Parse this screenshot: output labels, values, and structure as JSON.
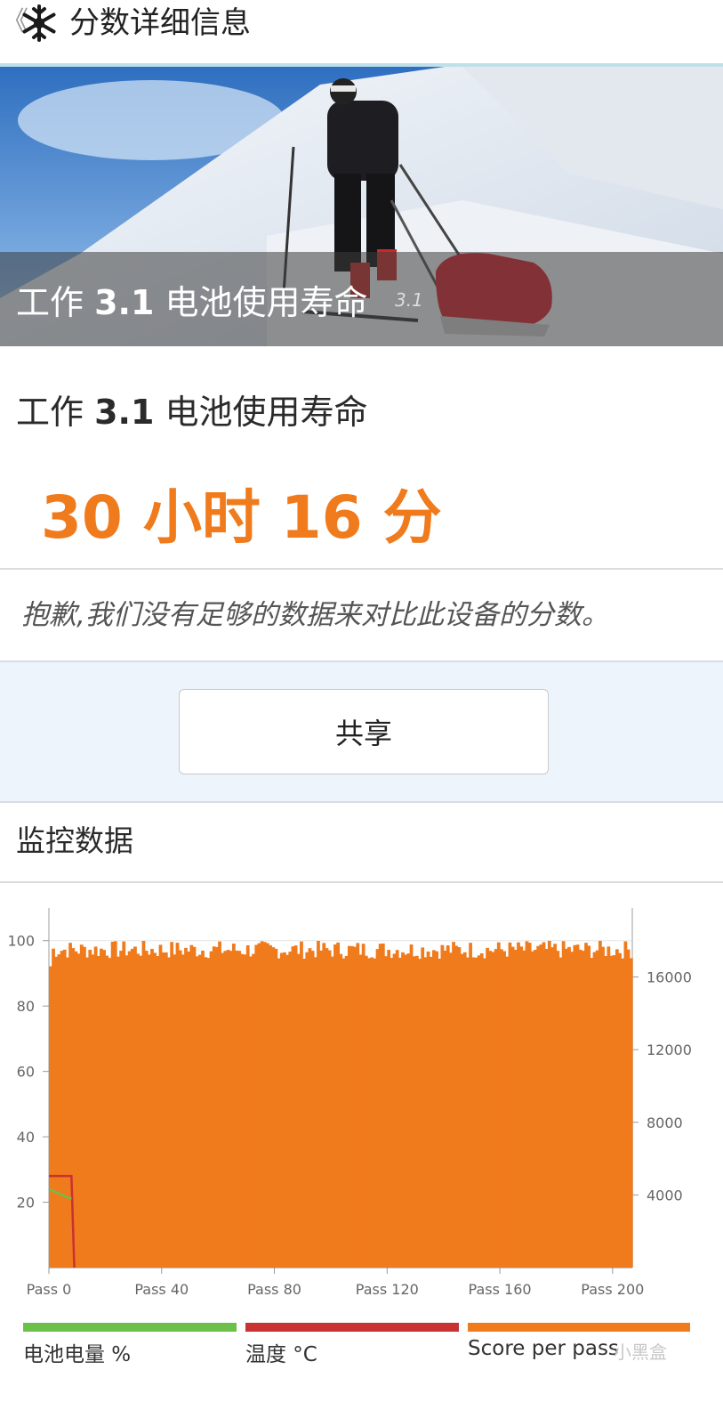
{
  "header": {
    "back_glyph": "《",
    "logo_icon": "snowflake-icon",
    "title": "分数详细信息"
  },
  "hero": {
    "label_pre": "工作 ",
    "label_num": "3.1",
    "label_post": " 电池使用寿命",
    "version": "3.1"
  },
  "result": {
    "name_pre": "工作 ",
    "name_num": "3.1",
    "name_post": " 电池使用寿命",
    "score": "30 小时 16 分",
    "no_compare": "抱歉,我们没有足够的数据来对比此设备的分数。"
  },
  "share_label": "共享",
  "monitor_title": "监控数据",
  "colors": {
    "accent": "#f07b1d",
    "battery": "#6cc04a",
    "temperature": "#c83232",
    "score": "#f07b1d"
  },
  "chart_data": {
    "type": "bar",
    "x_ticks": [
      "Pass 0",
      "Pass 40",
      "Pass 80",
      "Pass 120",
      "Pass 160",
      "Pass 200"
    ],
    "x_range": [
      0,
      207
    ],
    "y_left_ticks": [
      "100",
      "80",
      "60",
      "40",
      "20"
    ],
    "y_left_range": [
      0,
      110
    ],
    "y_right_ticks": [
      "16000",
      "12000",
      "8000",
      "4000"
    ],
    "y_right_range": [
      0,
      19800
    ],
    "series": [
      {
        "name": "电池电量 %",
        "axis": "left",
        "type": "line",
        "points": [
          [
            0,
            24
          ],
          [
            8,
            21
          ]
        ]
      },
      {
        "name": "温度 °C",
        "axis": "left",
        "type": "line",
        "points": [
          [
            0,
            28
          ],
          [
            8,
            28
          ],
          [
            9,
            0
          ]
        ]
      },
      {
        "name": "Score per pass",
        "axis": "right",
        "type": "bar",
        "base": 17500,
        "jitter": 500
      }
    ]
  },
  "legend": [
    {
      "label": "电池电量 %",
      "color": "#6cc04a"
    },
    {
      "label": "温度 °C",
      "color": "#c83232"
    },
    {
      "label": "Score per pass",
      "color": "#f07b1d"
    }
  ],
  "watermark": "小黑盒"
}
